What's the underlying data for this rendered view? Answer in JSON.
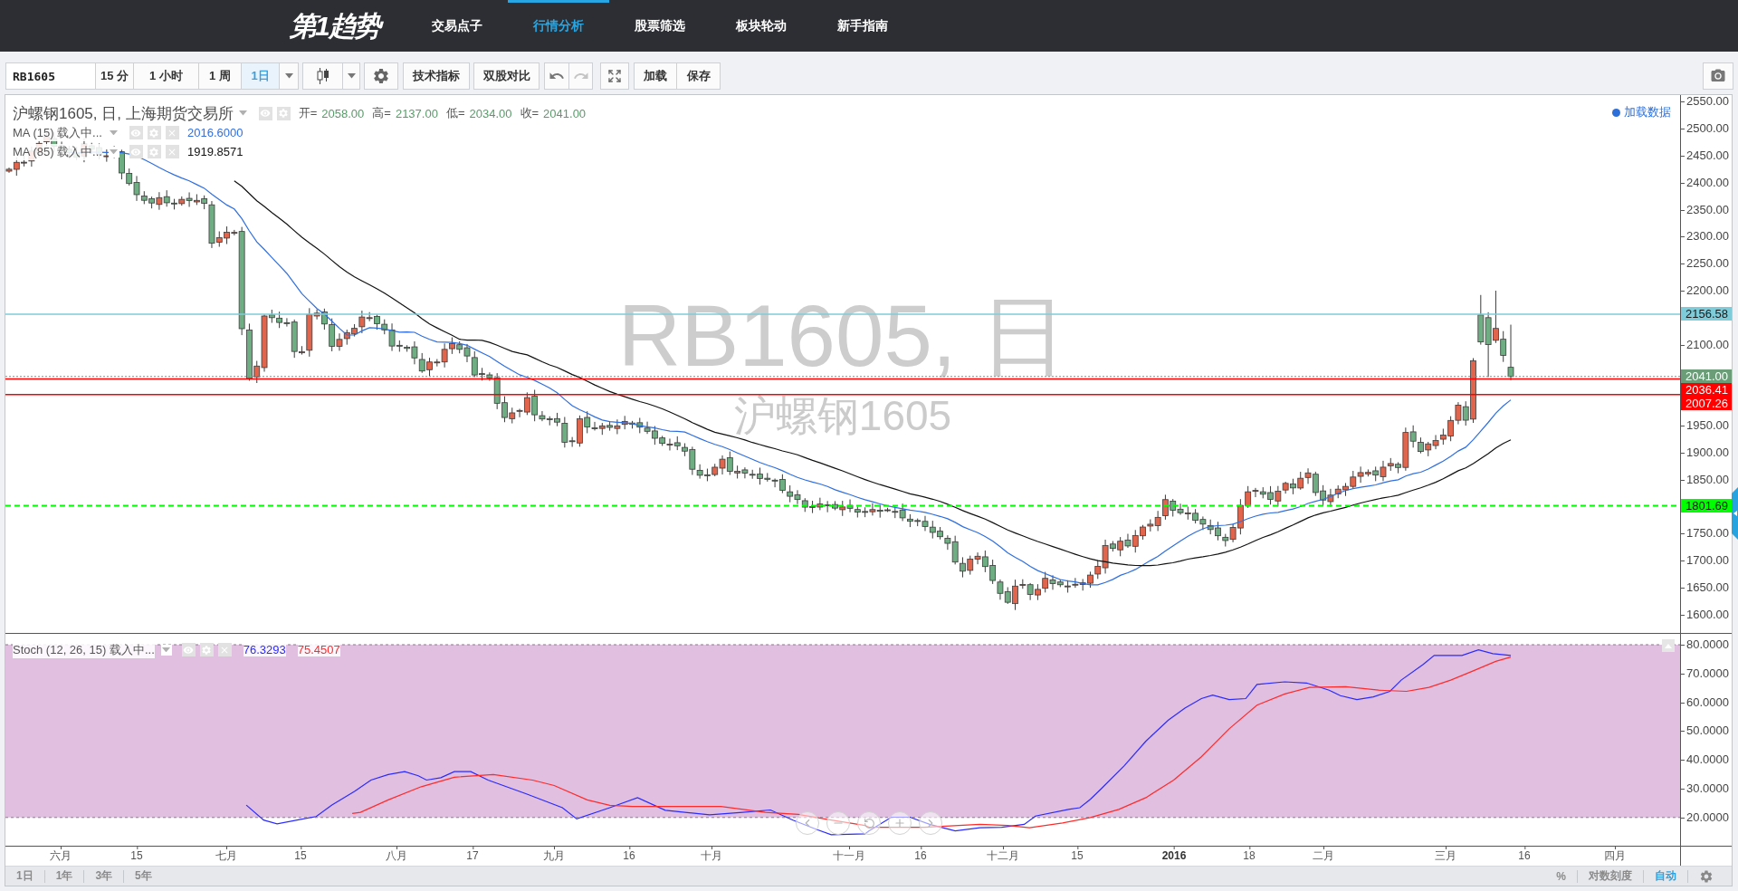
{
  "nav": {
    "logo": "第1趋势",
    "items": [
      {
        "label": "交易点子",
        "selected": false
      },
      {
        "label": "行情分析",
        "selected": true
      },
      {
        "label": "股票筛选",
        "selected": false
      },
      {
        "label": "板块轮动",
        "selected": false
      },
      {
        "label": "新手指南",
        "selected": false
      }
    ]
  },
  "toolbar": {
    "symbol": "RB1605",
    "intervals": [
      {
        "label": "15 分",
        "selected": false
      },
      {
        "label": "1 小时",
        "selected": false
      },
      {
        "label": "1 周",
        "selected": false
      },
      {
        "label": "1日",
        "selected": true
      }
    ],
    "tools": [
      "技术指标",
      "双股对比"
    ],
    "history": [
      {
        "kind": "undo",
        "disabled": false
      },
      {
        "kind": "redo",
        "disabled": true
      }
    ],
    "actions": [
      "加载",
      "保存"
    ]
  },
  "main_chart": {
    "title": "沪螺钢1605, 日, 上海期货交易所",
    "ohlc": [
      {
        "label": "开=",
        "value": "2058.00"
      },
      {
        "label": "高=",
        "value": "2137.00"
      },
      {
        "label": "低=",
        "value": "2034.00"
      },
      {
        "label": "收=",
        "value": "2041.00"
      }
    ],
    "indicators": [
      {
        "name": "MA (15) 载入中...",
        "value": "2016.6000",
        "color": "#2f6fe0"
      },
      {
        "name": "MA (85) 载入中...",
        "value": "1919.8571",
        "color": "#111111"
      }
    ],
    "data_link": "加载数据",
    "watermark": {
      "symbol": "RB1605, 日",
      "name": "沪螺钢1605"
    },
    "price_axis": [
      "2550.00",
      "2500.00",
      "2450.00",
      "2400.00",
      "2350.00",
      "2300.00",
      "2250.00",
      "2200.00",
      "2100.00",
      "1950.00",
      "1900.00",
      "1850.00",
      "1750.00",
      "1700.00",
      "1650.00",
      "1600.00"
    ],
    "price_markers": [
      {
        "value": "2156.58",
        "kind": "solid",
        "color": "#7ecbd9"
      },
      {
        "value": "2041.00",
        "kind": "last-price",
        "color": "#6b9e78"
      },
      {
        "value": "2036.41",
        "kind": "solid",
        "color": "#ff0000"
      },
      {
        "value": "2007.26",
        "kind": "solid",
        "color": "#ff0000"
      },
      {
        "value": "1801.69",
        "kind": "dashed",
        "color": "#00ff00"
      }
    ]
  },
  "stoch_pane": {
    "name": "Stoch (12, 26, 15) 载入中...",
    "values": [
      {
        "text": "76.3293",
        "color": "#2b2bff"
      },
      {
        "text": "75.4507",
        "color": "#ff2b2b"
      }
    ],
    "axis": [
      "80.0000",
      "70.0000",
      "60.0000",
      "50.0000",
      "40.0000",
      "30.0000",
      "20.0000"
    ]
  },
  "time_axis": [
    {
      "text": "六月",
      "kind": "date"
    },
    {
      "text": "15",
      "kind": "date"
    },
    {
      "text": "七月",
      "kind": "date"
    },
    {
      "text": "15",
      "kind": "date"
    },
    {
      "text": "八月",
      "kind": "date"
    },
    {
      "text": "17",
      "kind": "date"
    },
    {
      "text": "九月",
      "kind": "date"
    },
    {
      "text": "16",
      "kind": "date"
    },
    {
      "text": "十月",
      "kind": "date"
    },
    {
      "text": "十一月",
      "kind": "date"
    },
    {
      "text": "16",
      "kind": "date"
    },
    {
      "text": "十二月",
      "kind": "date"
    },
    {
      "text": "15",
      "kind": "date"
    },
    {
      "text": "2016",
      "kind": "year"
    },
    {
      "text": "18",
      "kind": "date"
    },
    {
      "text": "二月",
      "kind": "date"
    },
    {
      "text": "三月",
      "kind": "date"
    },
    {
      "text": "16",
      "kind": "date"
    },
    {
      "text": "四月",
      "kind": "date"
    }
  ],
  "bottom_bar": {
    "ranges": [
      "1日",
      "1年",
      "3年",
      "5年"
    ],
    "scale_options": [
      {
        "label": "%",
        "selected": false
      },
      {
        "label": "对数刻度",
        "selected": false
      },
      {
        "label": "自动",
        "selected": true
      }
    ]
  }
}
